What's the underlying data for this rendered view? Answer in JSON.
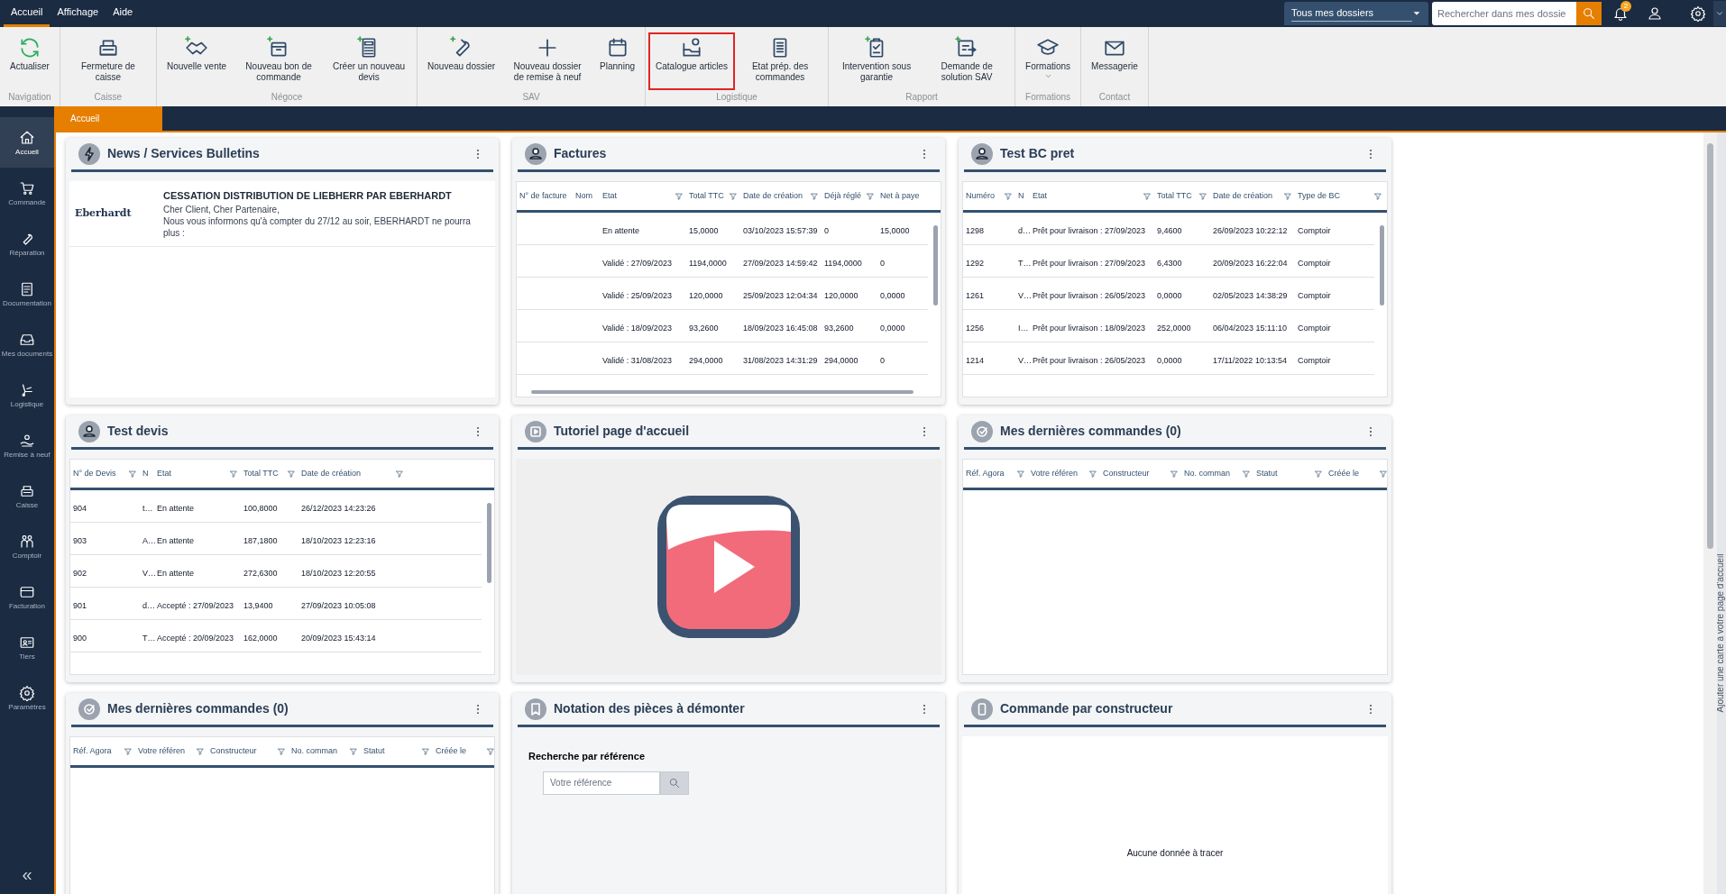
{
  "menu": [
    {
      "label": "Accueil",
      "selected": true
    },
    {
      "label": "Affichage",
      "selected": false
    },
    {
      "label": "Aide",
      "selected": false
    }
  ],
  "header": {
    "folder_select": "Tous mes dossiers",
    "search_placeholder": "Rechercher dans mes dossie",
    "notification_count": "2"
  },
  "ribbon": [
    {
      "group": "Navigation",
      "buttons": [
        {
          "label": "Actualiser",
          "highlighted": false
        }
      ]
    },
    {
      "group": "Caisse",
      "buttons": [
        {
          "label": "Fermeture de caisse",
          "highlighted": false
        }
      ]
    },
    {
      "group": "Négoce",
      "buttons": [
        {
          "label": "Nouvelle vente",
          "highlighted": false
        },
        {
          "label": "Nouveau bon de commande",
          "highlighted": false
        },
        {
          "label": "Créer un nouveau devis",
          "highlighted": false
        }
      ]
    },
    {
      "group": "SAV",
      "buttons": [
        {
          "label": "Nouveau dossier",
          "highlighted": false
        },
        {
          "label": "Nouveau dossier de remise à neuf",
          "highlighted": false
        },
        {
          "label": "Planning",
          "highlighted": false
        }
      ]
    },
    {
      "group": "Logistique",
      "buttons": [
        {
          "label": "Catalogue articles",
          "highlighted": true
        },
        {
          "label": "Etat prép. des commandes",
          "highlighted": false
        }
      ]
    },
    {
      "group": "Rapport",
      "buttons": [
        {
          "label": "Intervention sous garantie",
          "highlighted": false
        },
        {
          "label": "Demande de solution SAV",
          "highlighted": false
        }
      ]
    },
    {
      "group": "Formations",
      "buttons": [
        {
          "label": "Formations",
          "highlighted": false,
          "dropdown": true
        }
      ]
    },
    {
      "group": "Contact",
      "buttons": [
        {
          "label": "Messagerie",
          "highlighted": false
        }
      ]
    }
  ],
  "page_tabs": [
    {
      "label": "Accueil",
      "selected": true
    }
  ],
  "sidebar": {
    "items": [
      {
        "label": "Accueil",
        "selected": true
      },
      {
        "label": "Commande",
        "selected": false
      },
      {
        "label": "Réparation",
        "selected": false
      },
      {
        "label": "Documentation",
        "selected": false
      },
      {
        "label": "Mes documents",
        "selected": false
      },
      {
        "label": "Logistique",
        "selected": false
      },
      {
        "label": "Remise à neuf",
        "selected": false
      },
      {
        "label": "Caisse",
        "selected": false
      },
      {
        "label": "Comptoir",
        "selected": false
      },
      {
        "label": "Facturation",
        "selected": false
      },
      {
        "label": "Tiers",
        "selected": false
      },
      {
        "label": "Paramètres",
        "selected": false
      }
    ],
    "collapse": "«"
  },
  "cards": [
    {
      "kind": "news",
      "title": "News / Services Bulletins",
      "items": [
        {
          "source": "Eberhardt",
          "headline": "CESSATION DISTRIBUTION DE LIEBHERR PAR EBERHARDT",
          "body": "Cher Client, Cher Partenaire,\nNous vous informons qu'à compter du 27/12 au soir, EBERHARDT ne pourra plus :"
        }
      ]
    },
    {
      "kind": "table",
      "title": "Factures",
      "columns": [
        {
          "label": "N° de facture",
          "filter": false
        },
        {
          "label": "Nom",
          "filter": false
        },
        {
          "label": "Etat",
          "filter": true
        },
        {
          "label": "Total TTC",
          "filter": true
        },
        {
          "label": "Date de création",
          "filter": true
        },
        {
          "label": "Déjà réglé",
          "filter": true
        },
        {
          "label": "Net à paye",
          "filter": false
        }
      ],
      "rows": [
        [
          "",
          "",
          "En attente",
          "15,0000",
          "03/10/2023 15:57:39",
          "0",
          "15,0000"
        ],
        [
          "",
          "",
          "Validé : 27/09/2023",
          "1194,0000",
          "27/09/2023 14:59:42",
          "1194,0000",
          "0"
        ],
        [
          "",
          "",
          "Validé : 25/09/2023",
          "120,0000",
          "25/09/2023 12:04:34",
          "120,0000",
          "0,0000"
        ],
        [
          "",
          "",
          "Validé : 18/09/2023",
          "93,2600",
          "18/09/2023 16:45:08",
          "93,2600",
          "0,0000"
        ],
        [
          "",
          "",
          "Validé : 31/08/2023",
          "294,0000",
          "31/08/2023 14:31:29",
          "294,0000",
          "0"
        ]
      ]
    },
    {
      "kind": "table",
      "title": "Test BC pret",
      "columns": [
        {
          "label": "Numéro",
          "filter": true
        },
        {
          "label": "N",
          "filter": false
        },
        {
          "label": "Etat",
          "filter": true
        },
        {
          "label": "Total TTC",
          "filter": true
        },
        {
          "label": "Date de création",
          "filter": true
        },
        {
          "label": "Type de BC",
          "filter": true
        }
      ],
      "rows": [
        [
          "1298",
          "d…",
          "Prêt pour livraison : 27/09/2023",
          "9,4600",
          "26/09/2023 10:22:12",
          "Comptoir"
        ],
        [
          "1292",
          "T…",
          "Prêt pour livraison : 27/09/2023",
          "6,4300",
          "20/09/2023 16:22:04",
          "Comptoir"
        ],
        [
          "1261",
          "V…",
          "Prêt pour livraison : 26/05/2023",
          "0,0000",
          "02/05/2023 14:38:29",
          "Comptoir"
        ],
        [
          "1256",
          "I…",
          "Prêt pour livraison : 18/09/2023",
          "252,0000",
          "06/04/2023 15:11:10",
          "Comptoir"
        ],
        [
          "1214",
          "V…",
          "Prêt pour livraison : 26/05/2023",
          "0,0000",
          "17/11/2022 10:13:54",
          "Comptoir"
        ]
      ]
    },
    {
      "kind": "table",
      "title": "Test devis",
      "columns": [
        {
          "label": "N° de Devis",
          "filter": true
        },
        {
          "label": "N",
          "filter": false
        },
        {
          "label": "Etat",
          "filter": true
        },
        {
          "label": "Total TTC",
          "filter": true
        },
        {
          "label": "Date de création",
          "filter": true
        }
      ],
      "rows": [
        [
          "904",
          "t…",
          "En attente",
          "100,8000",
          "26/12/2023 14:23:26"
        ],
        [
          "903",
          "A…",
          "En attente",
          "187,1800",
          "18/10/2023 12:23:16"
        ],
        [
          "902",
          "V…",
          "En attente",
          "272,6300",
          "18/10/2023 12:20:55"
        ],
        [
          "901",
          "d…",
          "Accepté : 27/09/2023",
          "13,9400",
          "27/09/2023 10:05:08"
        ],
        [
          "900",
          "T…",
          "Accepté : 20/09/2023",
          "162,0000",
          "20/09/2023 15:43:14"
        ]
      ]
    },
    {
      "kind": "video",
      "title": "Tutoriel page d'accueil"
    },
    {
      "kind": "table",
      "title": "Mes dernières commandes (0)",
      "columns": [
        {
          "label": "Réf. Agora",
          "filter": true
        },
        {
          "label": "Votre référen",
          "filter": true
        },
        {
          "label": "Constructeur",
          "filter": true
        },
        {
          "label": "No. comman",
          "filter": true
        },
        {
          "label": "Statut",
          "filter": true
        },
        {
          "label": "Créée le",
          "filter": true
        }
      ]
    },
    {
      "kind": "table",
      "title": "Mes dernières commandes (0)",
      "columns": [
        {
          "label": "Réf. Agora",
          "filter": true
        },
        {
          "label": "Votre référen",
          "filter": true
        },
        {
          "label": "Constructeur",
          "filter": true
        },
        {
          "label": "No. comman",
          "filter": true
        },
        {
          "label": "Statut",
          "filter": true
        },
        {
          "label": "Créée le",
          "filter": true
        }
      ]
    },
    {
      "kind": "search",
      "title": "Notation des pièces à démonter",
      "label": "Recherche par référence",
      "placeholder": "Votre référence"
    },
    {
      "kind": "chart-empty",
      "title": "Commande par constructeur",
      "message": "Aucune donnée à tracer"
    }
  ],
  "side_tab": "Ajouter une carte à votre page d'accueil"
}
